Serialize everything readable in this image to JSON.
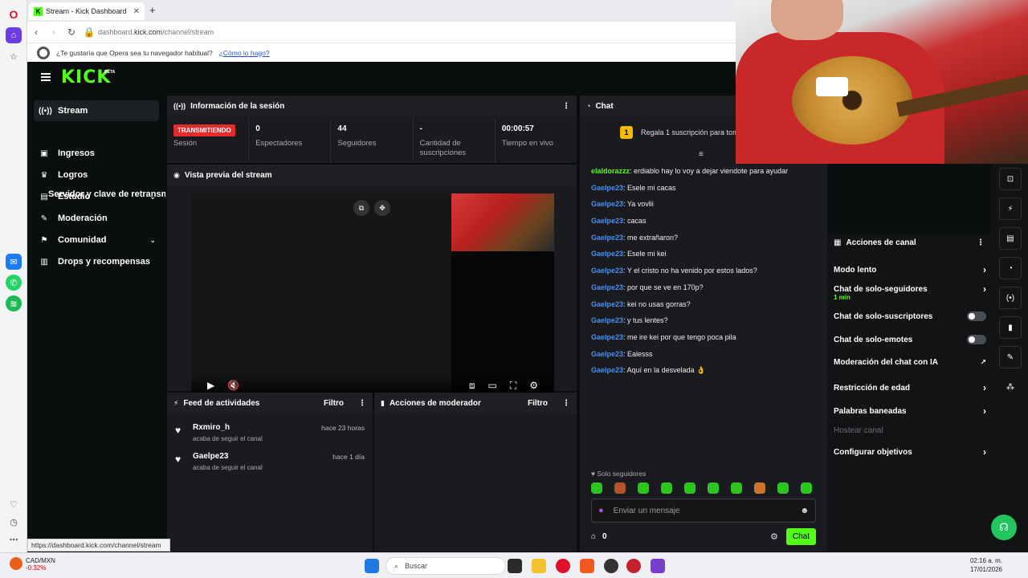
{
  "browser": {
    "tab_title": "Stream - Kick Dashboard",
    "tab_favicon": "K",
    "url_prefix": "dashboard.",
    "url_host": "kick.com",
    "url_path": "/channel/stream",
    "promo_text": "¿Te gustaría que Opera sea tu navegador habitual?",
    "promo_link": "¿Cómo lo hago?",
    "status_url": "https://dashboard.kick.com/channel/stream"
  },
  "kick": {
    "logo": "KICK",
    "beta": "BETA",
    "accent": "#53fc18"
  },
  "sidebar": {
    "items": [
      {
        "label": "Stream",
        "icon": "broadcast-icon"
      },
      {
        "label": "Ingresos",
        "icon": "money-icon"
      },
      {
        "label": "Logros",
        "icon": "trophy-icon"
      },
      {
        "label": "Estudio",
        "icon": "studio-icon"
      },
      {
        "label": "Moderación",
        "icon": "wrench-icon"
      },
      {
        "label": "Comunidad",
        "icon": "community-icon"
      },
      {
        "label": "Drops y recompensas",
        "icon": "drops-icon"
      }
    ],
    "sub_item": "Servidor y clave de retransmisión"
  },
  "session": {
    "title": "Información de la sesión",
    "live_badge": "TRANSMITIENDO",
    "stats": [
      {
        "value": "",
        "label": "Sesión"
      },
      {
        "value": "0",
        "label": "Espectadores"
      },
      {
        "value": "44",
        "label": "Seguidores"
      },
      {
        "value": "-",
        "label": "Cantidad de suscripciones"
      },
      {
        "value": "00:00:57",
        "label": "Tiempo en vivo"
      }
    ]
  },
  "preview": {
    "title": "Vista previa del stream"
  },
  "activity": {
    "title": "Feed de actividades",
    "filter": "Filtro",
    "rows": [
      {
        "name": "Rxmiro_h",
        "time": "hace 23 horas",
        "sub": "acaba de seguir el canal"
      },
      {
        "name": "Gaelpe23",
        "time": "hace 1 día",
        "sub": "acaba de seguir el canal"
      }
    ]
  },
  "modactions": {
    "title": "Acciones de moderador",
    "filter": "Filtro"
  },
  "chat": {
    "title": "Chat",
    "gift_text": "Regala 1 suscripción para tom",
    "messages": [
      {
        "user": "elaldorazzz",
        "text": ": erdiablo hay lo voy a dejar viendote para ayudar",
        "color": "#53fc18"
      },
      {
        "user": "Gaelpe23",
        "text": ": Esele mi cacas",
        "color": "#4b8ff0"
      },
      {
        "user": "Gaelpe23",
        "text": ": Ya vovlii",
        "color": "#4b8ff0"
      },
      {
        "user": "Gaelpe23",
        "text": ": cacas",
        "color": "#4b8ff0"
      },
      {
        "user": "Gaelpe23",
        "text": ": me extrañaron?",
        "color": "#4b8ff0"
      },
      {
        "user": "Gaelpe23",
        "text": ": Esele mi kei",
        "color": "#4b8ff0"
      },
      {
        "user": "Gaelpe23",
        "text": ": Y el cristo no ha venido por estos lados?",
        "color": "#4b8ff0"
      },
      {
        "user": "Gaelpe23",
        "text": ": por que se ve en 170p?",
        "color": "#4b8ff0"
      },
      {
        "user": "Gaelpe23",
        "text": ": kei no usas gorras?",
        "color": "#4b8ff0"
      },
      {
        "user": "Gaelpe23",
        "text": ": y tus lentes?",
        "color": "#4b8ff0"
      },
      {
        "user": "Gaelpe23",
        "text": ": me ire kei por que tengo poca pila",
        "color": "#4b8ff0"
      },
      {
        "user": "Gaelpe23",
        "text": ": Ealesss",
        "color": "#4b8ff0"
      },
      {
        "user": "Gaelpe23",
        "text": ": Aquí en la desvelada 👌",
        "color": "#4b8ff0"
      }
    ],
    "solo": "Solo seguidores",
    "placeholder": "Enviar un mensaje",
    "count": "0",
    "send": "Chat"
  },
  "channel_actions": {
    "title": "Acciones de canal",
    "rows": [
      {
        "label": "Modo lento",
        "kind": "arrow"
      },
      {
        "label": "Chat de solo-seguidores",
        "kind": "arrow",
        "sub": "1 min"
      },
      {
        "label": "Chat de solo-suscriptores",
        "kind": "toggle"
      },
      {
        "label": "Chat de solo-emotes",
        "kind": "toggle"
      },
      {
        "label": "Moderación del chat con IA",
        "kind": "external"
      },
      {
        "label": "Restricción de edad",
        "kind": "arrow"
      },
      {
        "label": "Palabras baneadas",
        "kind": "arrow"
      },
      {
        "label": "Hostear canal",
        "kind": "disabled"
      },
      {
        "label": "Configurar objetivos",
        "kind": "arrow"
      }
    ]
  },
  "taskbar": {
    "ticker": "CAD/MXN",
    "change": "-0.32%",
    "search": "Buscar",
    "time": "02:16 a. m.",
    "date": "17/01/2026"
  }
}
